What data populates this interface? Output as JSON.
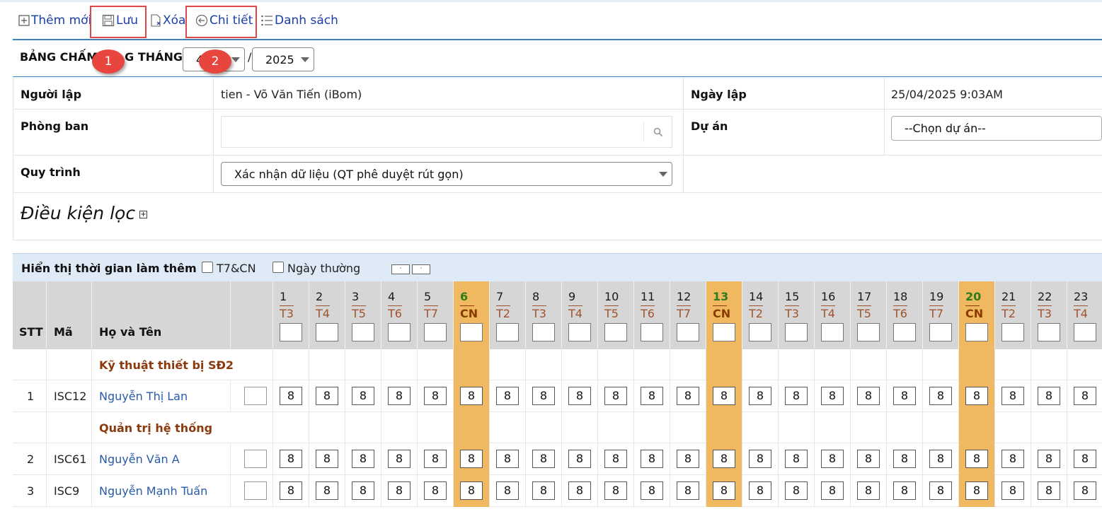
{
  "toolbar": {
    "add_label": "Thêm mới",
    "save_label": "Lưu",
    "delete_label": "Xóa",
    "detail_label": "Chi tiết",
    "list_label": "Danh sách"
  },
  "annotations": {
    "badge1": "1",
    "badge2": "2"
  },
  "header": {
    "title_visible": "BẢNG CHẤM",
    "title_tail": "G THÁNG",
    "month_value": "4",
    "separator": "/",
    "year_value": "2025"
  },
  "info": {
    "creator_label": "Người lập",
    "creator_value": "tien - Võ Văn Tiến (iBom)",
    "created_date_label": "Ngày lập",
    "created_date_value": "25/04/2025 9:03AM",
    "department_label": "Phòng ban",
    "project_label": "Dự án",
    "project_value": "--Chọn dự án--",
    "process_label": "Quy trình",
    "process_value": "Xác nhận dữ liệu (QT phê duyệt rút gọn)"
  },
  "filter": {
    "title": "Điều kiện lọc"
  },
  "overtime": {
    "title": "Hiển thị thời gian làm thêm",
    "weekend_label": "T7&CN",
    "weekday_label": "Ngày thường"
  },
  "table": {
    "col_stt": "STT",
    "col_code": "Mã",
    "col_name": "Họ và Tên",
    "days": [
      {
        "d": "1",
        "w": "T3",
        "cn": false
      },
      {
        "d": "2",
        "w": "T4",
        "cn": false
      },
      {
        "d": "3",
        "w": "T5",
        "cn": false
      },
      {
        "d": "4",
        "w": "T6",
        "cn": false
      },
      {
        "d": "5",
        "w": "T7",
        "cn": false
      },
      {
        "d": "6",
        "w": "CN",
        "cn": true
      },
      {
        "d": "7",
        "w": "T2",
        "cn": false
      },
      {
        "d": "8",
        "w": "T3",
        "cn": false
      },
      {
        "d": "9",
        "w": "T4",
        "cn": false
      },
      {
        "d": "10",
        "w": "T5",
        "cn": false
      },
      {
        "d": "11",
        "w": "T6",
        "cn": false
      },
      {
        "d": "12",
        "w": "T7",
        "cn": false
      },
      {
        "d": "13",
        "w": "CN",
        "cn": true
      },
      {
        "d": "14",
        "w": "T2",
        "cn": false
      },
      {
        "d": "15",
        "w": "T3",
        "cn": false
      },
      {
        "d": "16",
        "w": "T4",
        "cn": false
      },
      {
        "d": "17",
        "w": "T5",
        "cn": false
      },
      {
        "d": "18",
        "w": "T6",
        "cn": false
      },
      {
        "d": "19",
        "w": "T7",
        "cn": false
      },
      {
        "d": "20",
        "w": "CN",
        "cn": true
      },
      {
        "d": "21",
        "w": "T2",
        "cn": false
      },
      {
        "d": "22",
        "w": "T3",
        "cn": false
      },
      {
        "d": "23",
        "w": "T4",
        "cn": false
      }
    ],
    "rows": [
      {
        "type": "group",
        "name": "Kỹ thuật thiết bị SĐ2"
      },
      {
        "type": "emp",
        "stt": "1",
        "code": "ISC12",
        "name": "Nguyễn Thị Lan",
        "value": "8"
      },
      {
        "type": "group",
        "name": "Quản trị hệ thống"
      },
      {
        "type": "emp",
        "stt": "2",
        "code": "ISC61",
        "name": "Nguyễn Văn A",
        "value": "8"
      },
      {
        "type": "emp",
        "stt": "3",
        "code": "ISC9",
        "name": "Nguyễn Mạnh Tuấn",
        "value": "8"
      }
    ]
  }
}
